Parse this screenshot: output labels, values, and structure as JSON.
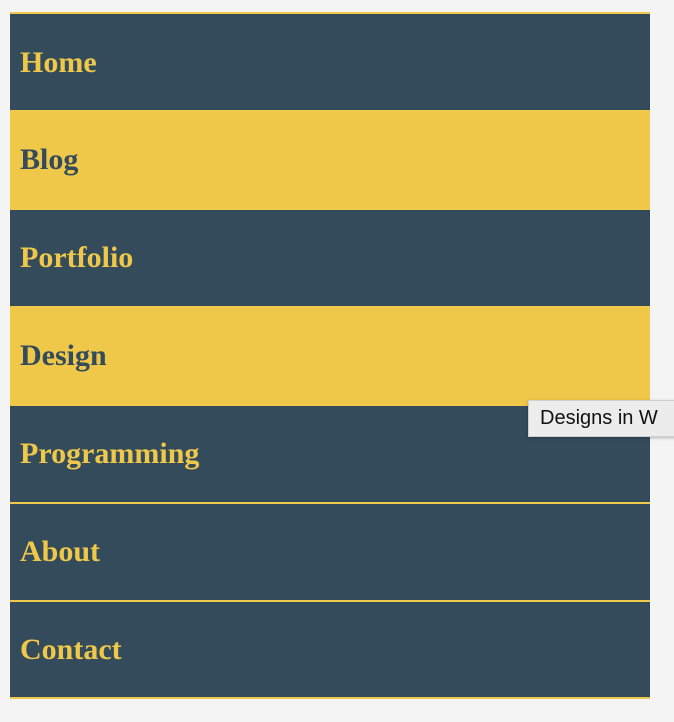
{
  "nav": {
    "items": [
      {
        "label": "Home",
        "active": false
      },
      {
        "label": "Blog",
        "active": true
      },
      {
        "label": "Portfolio",
        "active": false
      },
      {
        "label": "Design",
        "active": true
      },
      {
        "label": "Programming",
        "active": false
      },
      {
        "label": "About",
        "active": false
      },
      {
        "label": "Contact",
        "active": false
      }
    ]
  },
  "tooltip": {
    "text": "Designs in W"
  },
  "colors": {
    "nav_background": "#344b5b",
    "accent": "#efc84a",
    "page_background": "#f4f4f4",
    "tooltip_background": "#ececec"
  }
}
